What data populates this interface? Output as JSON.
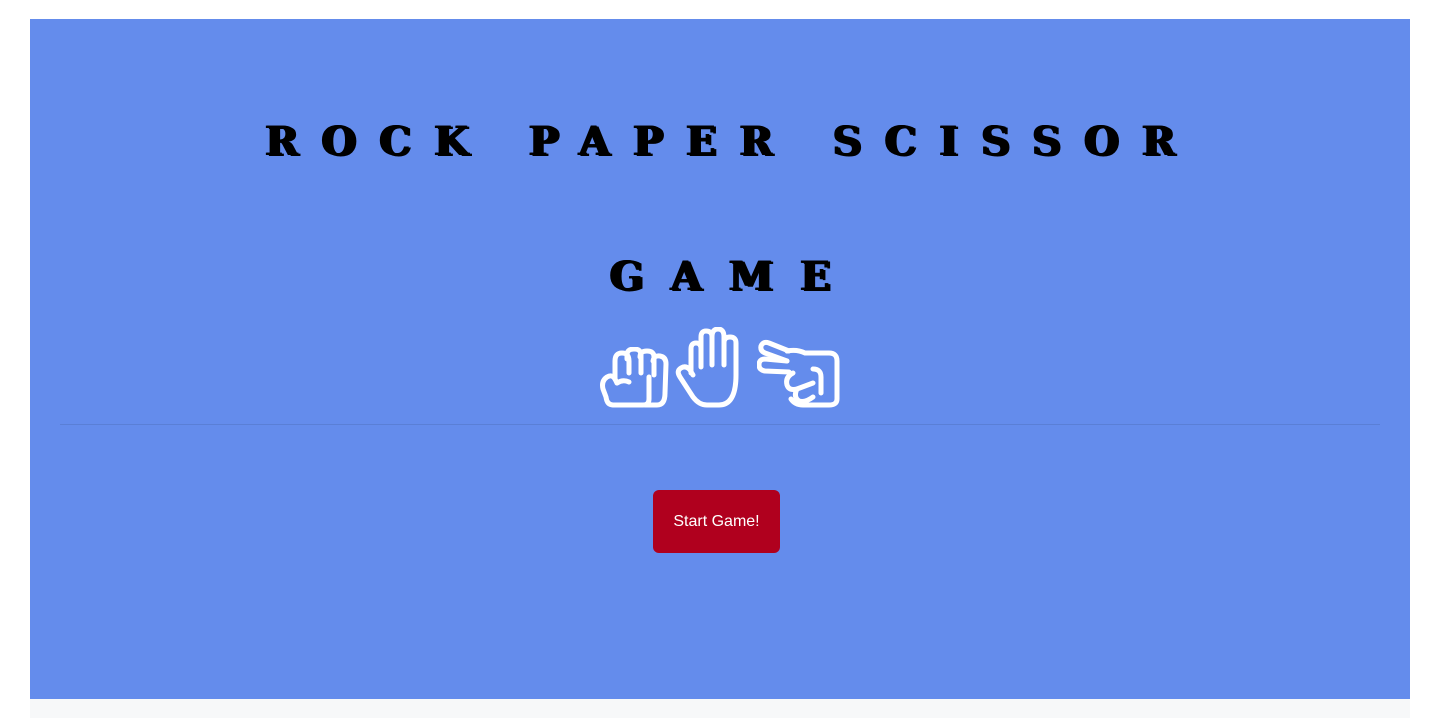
{
  "header": {
    "title_line_1": "ROCK PAPER SCISSOR",
    "title_line_2": "GAME"
  },
  "hands": [
    {
      "name": "rock",
      "icon": "fist-icon"
    },
    {
      "name": "paper",
      "icon": "open-hand-icon"
    },
    {
      "name": "scissors",
      "icon": "scissors-hand-icon"
    }
  ],
  "actions": {
    "start_label": "Start Game!"
  },
  "colors": {
    "panel_background": "#648cec",
    "button_background": "#b0001e",
    "icon_stroke": "#ffffff",
    "title_text": "#000000"
  }
}
